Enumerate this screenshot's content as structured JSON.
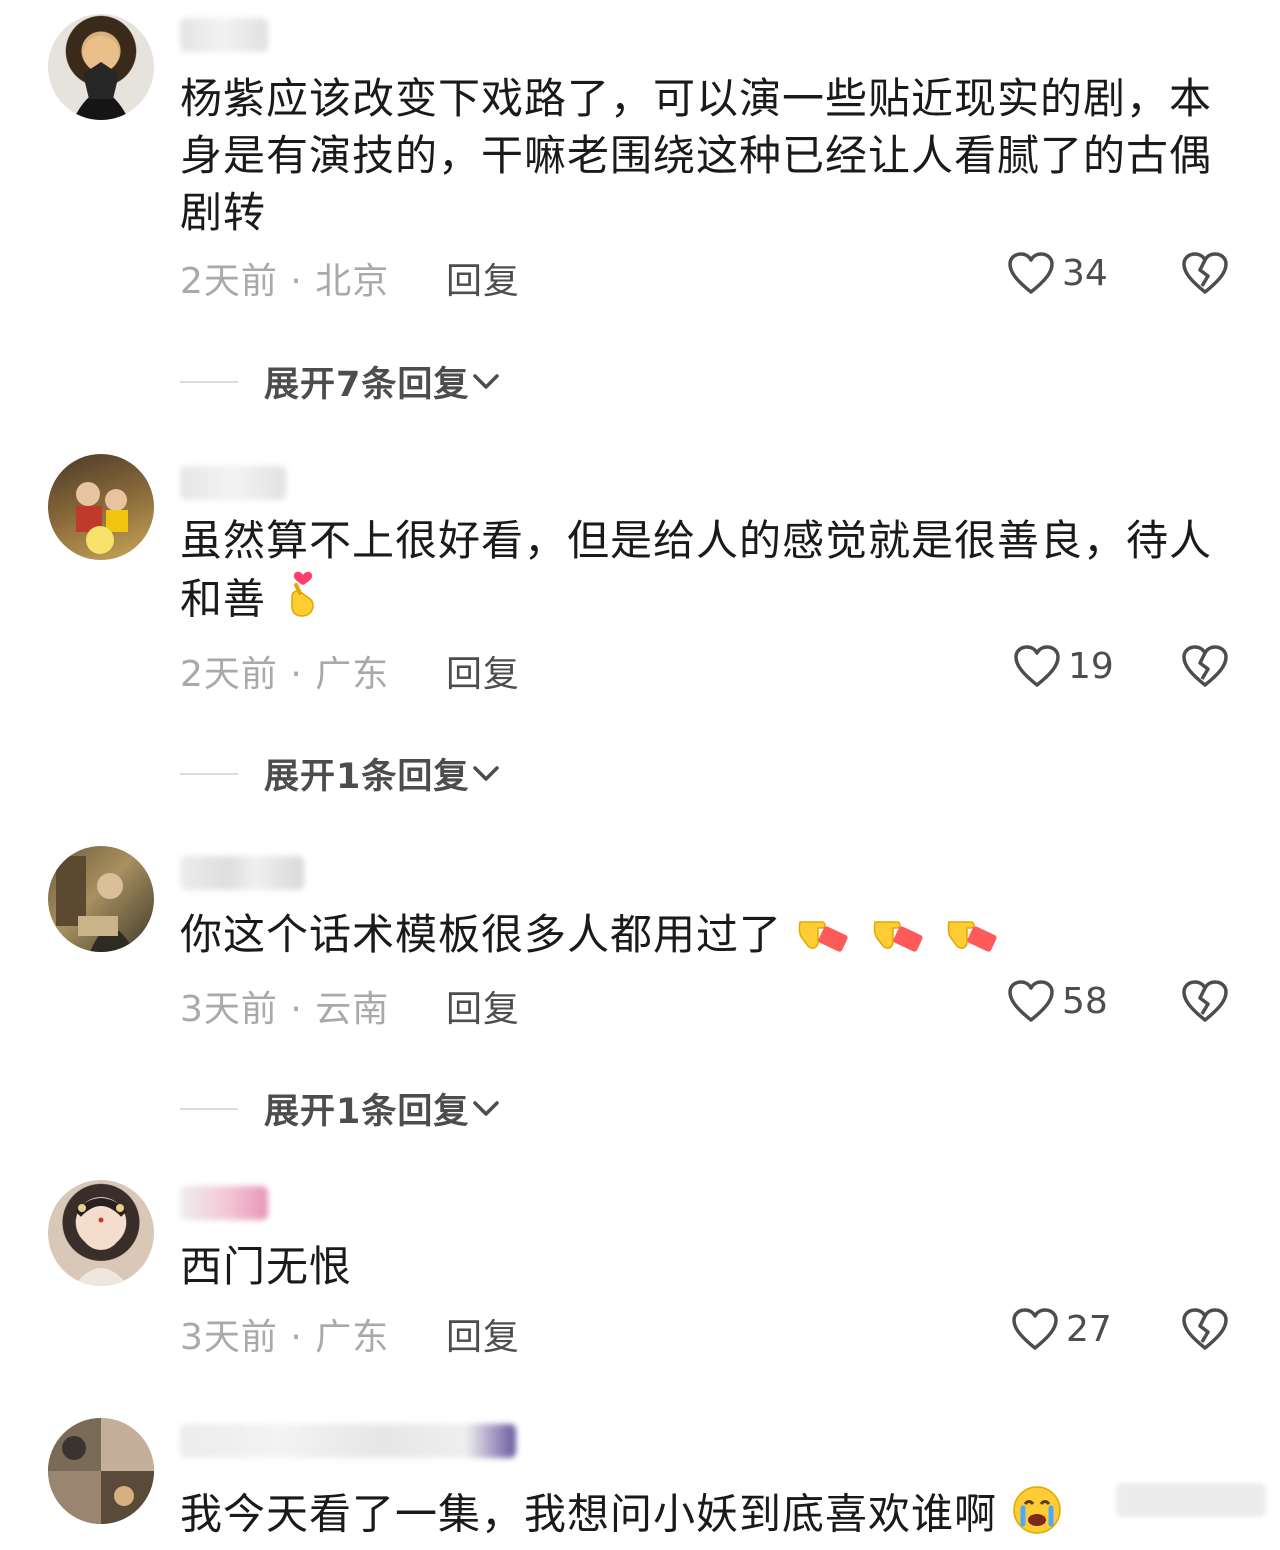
{
  "comments": [
    {
      "text": "杨紫应该改变下戏路了，可以演一些贴近现实的剧，本身是有演技的，干嘛老围绕这种已经让人看腻了的古偶剧转",
      "time_location": "2天前 · 北京",
      "reply_label": "回复",
      "likes": "34",
      "expand_label": "展开7条回复"
    },
    {
      "text": "虽然算不上很好看，但是给人的感觉就是很善良，待人和善",
      "time_location": "2天前 · 广东",
      "reply_label": "回复",
      "likes": "19",
      "expand_label": "展开1条回复"
    },
    {
      "text": "你这个话术模板很多人都用过了",
      "time_location": "3天前 · 云南",
      "reply_label": "回复",
      "likes": "58",
      "expand_label": "展开1条回复"
    },
    {
      "text": "西门无恨",
      "time_location": "3天前 · 广东",
      "reply_label": "回复",
      "likes": "27"
    },
    {
      "text": "我今天看了一集，我想问小妖到底喜欢谁啊"
    }
  ],
  "icons": {
    "like": "heart-outline-icon",
    "dislike": "broken-heart-icon",
    "expand": "chevron-down-icon",
    "emoji_heart_hand": "finger-heart-emoji",
    "emoji_pointing": "pointing-hand-emoji",
    "emoji_crying": "crying-face-emoji"
  },
  "colors": {
    "text": "#1a1a1a",
    "meta": "#a9a9a9",
    "action": "#4d4d4d",
    "divider": "#dcdcdc"
  }
}
